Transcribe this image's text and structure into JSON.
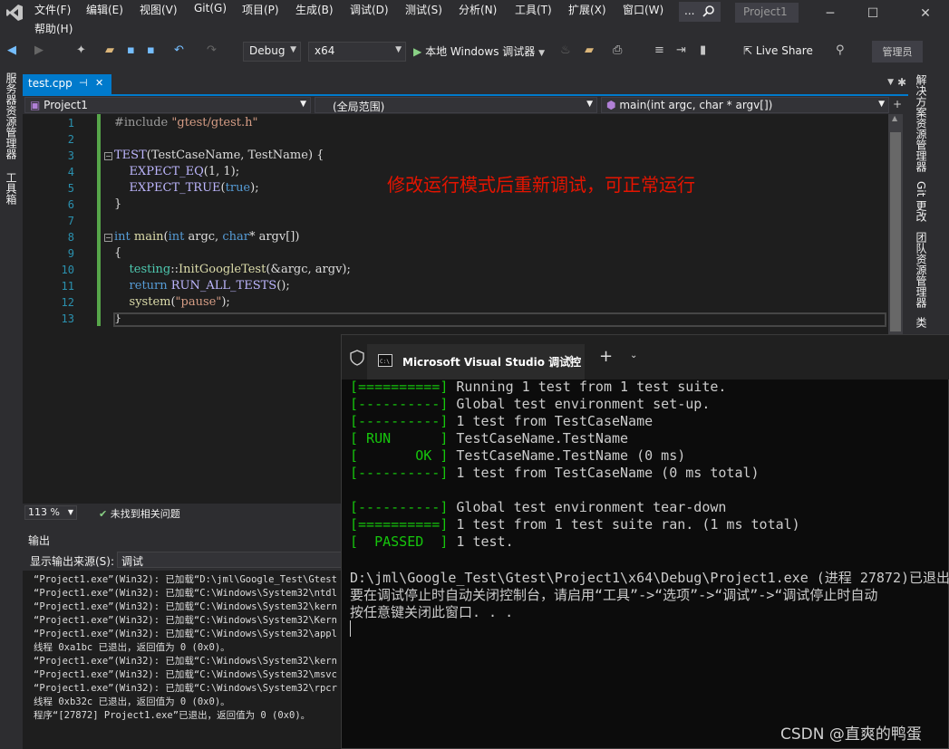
{
  "menu": [
    "文件(F)",
    "编辑(E)",
    "视图(V)",
    "Git(G)",
    "项目(P)",
    "生成(B)",
    "调试(D)",
    "测试(S)",
    "分析(N)",
    "工具(T)",
    "扩展(X)",
    "窗口(W)",
    "帮助(H)"
  ],
  "search_label": "...",
  "solution_title": "Project1",
  "toolbar": {
    "config": "Debug",
    "platform": "x64",
    "run_label": "本地 Windows 调试器",
    "live_share": "Live Share",
    "admin": "管理员"
  },
  "tab": {
    "name": "test.cpp",
    "pin": "⊣",
    "close": "✕"
  },
  "nav": {
    "project": "Project1",
    "scope": "(全局范围)",
    "member": "main(int argc, char * argv[])"
  },
  "code_lines": [
    {
      "n": "1",
      "html": "<span class='pp'>#include</span> <span class='str'>\"gtest/gtest.h\"</span>"
    },
    {
      "n": "2",
      "html": ""
    },
    {
      "n": "3",
      "html": "<span class='mac'>TEST</span>(TestCaseName, TestName) {"
    },
    {
      "n": "4",
      "html": "    <span class='mac'>EXPECT_EQ</span>(1, 1);"
    },
    {
      "n": "5",
      "html": "    <span class='mac'>EXPECT_TRUE</span>(<span class='kw'>true</span>);"
    },
    {
      "n": "6",
      "html": "}"
    },
    {
      "n": "7",
      "html": ""
    },
    {
      "n": "8",
      "html": "<span class='kw'>int</span> <span class='fn'>main</span>(<span class='kw'>int</span> argc, <span class='kw'>char</span>* argv[])"
    },
    {
      "n": "9",
      "html": "{"
    },
    {
      "n": "10",
      "html": "    <span class='ty'>testing</span>::<span class='fn'>InitGoogleTest</span>(&amp;argc, argv);"
    },
    {
      "n": "11",
      "html": "    <span class='kw'>return</span> <span class='mac'>RUN_ALL_TESTS</span>();"
    },
    {
      "n": "12",
      "html": "    <span class='fn'>system</span>(<span class='str'>\"pause\"</span>);"
    },
    {
      "n": "13",
      "html": "}"
    }
  ],
  "annotation": "修改运行模式后重新调试，可正常运行",
  "status": {
    "zoom": "113 %",
    "issues": "未找到相关问题"
  },
  "right_tabs": [
    "解决方案资源管理器",
    "Git 更改",
    "团队资源管理器",
    "类"
  ],
  "left_tabs": [
    "服务器资源管理器",
    "工具箱"
  ],
  "output": {
    "title": "输出",
    "source_label": "显示输出来源(S):",
    "source_value": "调试",
    "lines": [
      "“Project1.exe”(Win32): 已加载“D:\\jml\\Google_Test\\Gtest",
      "“Project1.exe”(Win32): 已加载“C:\\Windows\\System32\\ntdl",
      "“Project1.exe”(Win32): 已加载“C:\\Windows\\System32\\kern",
      "“Project1.exe”(Win32): 已加载“C:\\Windows\\System32\\Kern",
      "“Project1.exe”(Win32): 已加载“C:\\Windows\\System32\\appl",
      "线程 0xa1bc 已退出，返回值为 0 (0x0)。",
      "“Project1.exe”(Win32): 已加载“C:\\Windows\\System32\\kern",
      "“Project1.exe”(Win32): 已加载“C:\\Windows\\System32\\msvc",
      "“Project1.exe”(Win32): 已加载“C:\\Windows\\System32\\rpcr",
      "线程 0xb32c 已退出，返回值为 0 (0x0)。",
      "程序“[27872] Project1.exe”已退出，返回值为 0 (0x0)。"
    ]
  },
  "console": {
    "tab_title": "Microsoft Visual Studio 调试控",
    "lines": [
      {
        "tag": "[==========]",
        "text": " Running 1 test from 1 test suite."
      },
      {
        "tag": "[----------]",
        "text": " Global test environment set-up."
      },
      {
        "tag": "[----------]",
        "text": " 1 test from TestCaseName"
      },
      {
        "tag": "[ RUN      ]",
        "text": " TestCaseName.TestName"
      },
      {
        "tag": "[       OK ]",
        "text": " TestCaseName.TestName (0 ms)"
      },
      {
        "tag": "[----------]",
        "text": " 1 test from TestCaseName (0 ms total)"
      },
      {
        "tag": "",
        "text": ""
      },
      {
        "tag": "[----------]",
        "text": " Global test environment tear-down"
      },
      {
        "tag": "[==========]",
        "text": " 1 test from 1 test suite ran. (1 ms total)"
      },
      {
        "tag": "[  PASSED  ]",
        "text": " 1 test."
      },
      {
        "tag": "",
        "text": ""
      },
      {
        "tag": "",
        "text": "D:\\jml\\Google_Test\\Gtest\\Project1\\x64\\Debug\\Project1.exe (进程 27872)已退出"
      },
      {
        "tag": "",
        "text": "要在调试停止时自动关闭控制台，请启用“工具”->“选项”->“调试”->“调试停止时自动"
      },
      {
        "tag": "",
        "text": "按任意键关闭此窗口. . ."
      }
    ]
  },
  "watermark": "CSDN @直爽的鸭蛋",
  "colors": {
    "accent": "#007acc",
    "console_green": "#16c60c",
    "annotation_red": "#e51400"
  }
}
